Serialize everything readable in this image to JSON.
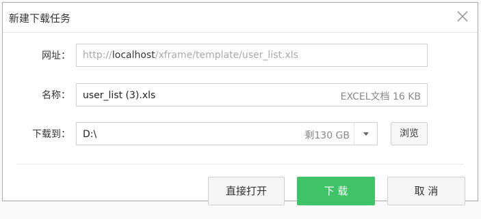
{
  "dialog": {
    "title": "新建下载任务",
    "close_icon": "close-icon"
  },
  "url": {
    "label": "网址：",
    "prefix": "http://",
    "host": "localhost",
    "path": "/xframe/template/user_list.xls"
  },
  "name": {
    "label": "名称：",
    "value": "user_list (3).xls",
    "file_meta": "EXCEL文档 16 KB"
  },
  "save_to": {
    "label": "下载到：",
    "value": "D:\\",
    "free_space": "剩130 GB",
    "dropdown_icon": "chevron-down-icon",
    "browse_label": "浏览"
  },
  "actions": {
    "open_label": "直接打开",
    "download_label": "下 载",
    "cancel_label": "取 消"
  },
  "colors": {
    "primary": "#3ec466",
    "border": "#cfcfcf"
  }
}
